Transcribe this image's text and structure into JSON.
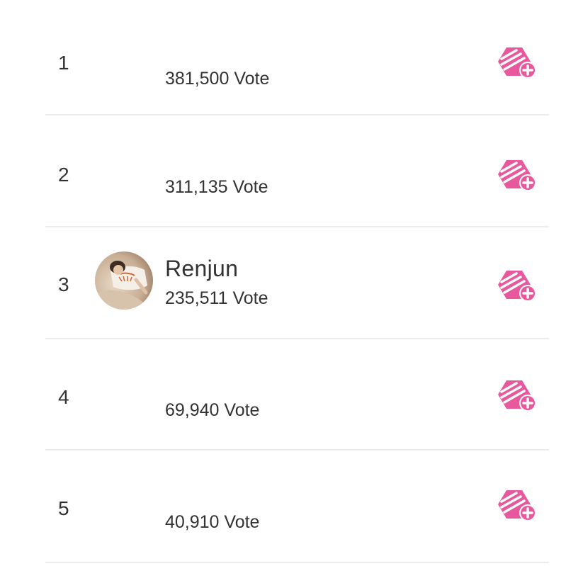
{
  "leaderboard": {
    "accent_color": "#e8589c",
    "entries": [
      {
        "rank": "1",
        "name": "",
        "votes": "381,500 Vote",
        "icon": "vote-add-icon"
      },
      {
        "rank": "2",
        "name": "",
        "votes": "311,135 Vote",
        "icon": "vote-add-icon"
      },
      {
        "rank": "3",
        "name": "Renjun",
        "votes": "235,511 Vote",
        "icon": "vote-add-icon",
        "avatar": "profile-photo"
      },
      {
        "rank": "4",
        "name": "",
        "votes": "69,940 Vote",
        "icon": "vote-add-icon"
      },
      {
        "rank": "5",
        "name": "",
        "votes": "40,910 Vote",
        "icon": "vote-add-icon"
      }
    ]
  }
}
